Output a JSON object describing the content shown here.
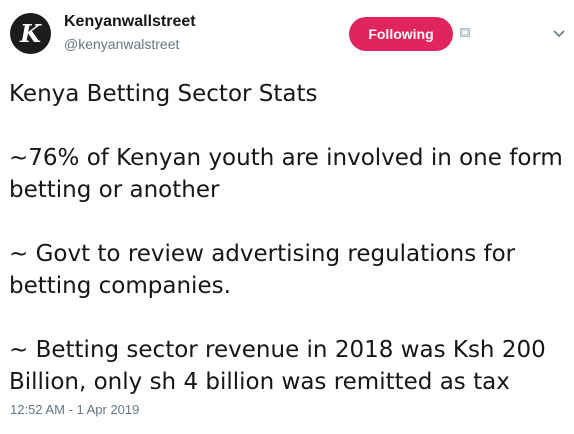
{
  "header": {
    "avatar_letter": "K",
    "display_name": "Kenyanwallstreet",
    "handle": "@kenyanwalstreet",
    "follow_label": "Following",
    "icons": [
      "card-icon",
      "chevron-down-icon"
    ]
  },
  "tweet": {
    "lines": [
      "Kenya Betting Sector Stats",
      "~76% of Kenyan youth are involved in one form betting or another",
      "~ Govt to review advertising regulations for betting companies.",
      "~ Betting sector revenue in 2018 was Ksh 200 Billion, only sh 4 billion was remitted as tax"
    ],
    "timestamp": "12:52 AM - 1 Apr 2019"
  },
  "colors": {
    "follow_button": "#e0245e",
    "secondary_text": "#657786",
    "primary_text": "#14171a"
  }
}
